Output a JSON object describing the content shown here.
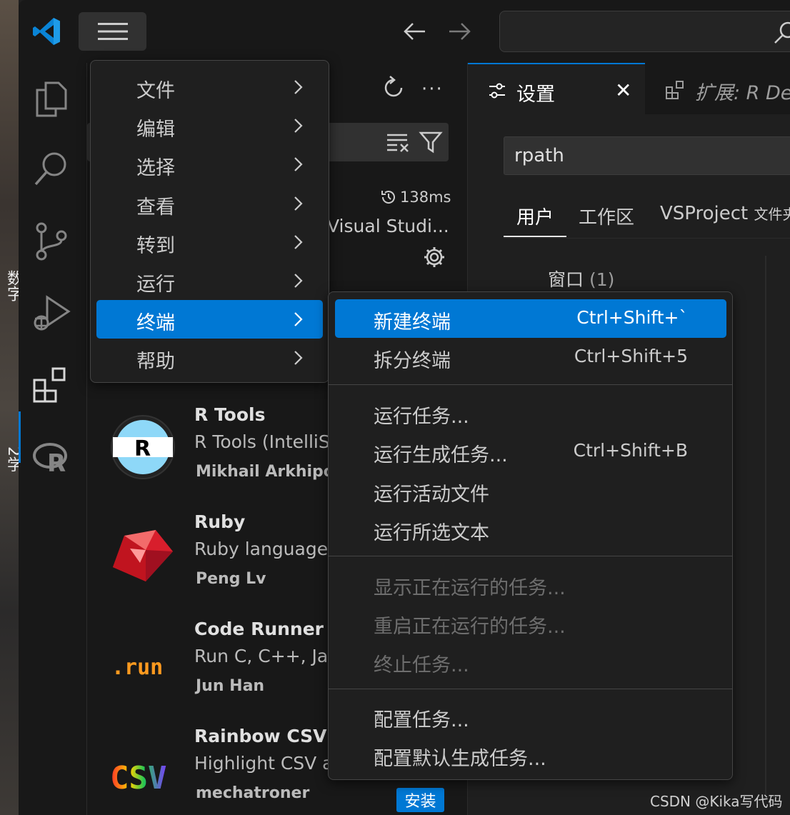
{
  "desktop": {
    "fragments": [
      "数字",
      "2学"
    ]
  },
  "titlebar": {
    "search_value": ""
  },
  "sidebar": {
    "response_time": "138ms",
    "source_label": "Visual Studi...",
    "extensions": [
      {
        "name": "R Tools",
        "description": "R Tools (IntelliSe",
        "author": "Mikhail Arkhipov",
        "icon_text": "R"
      },
      {
        "name": "Ruby",
        "description": "Ruby language",
        "author": "Peng Lv"
      },
      {
        "name": "Code Runner",
        "description": "Run C, C++, Jav",
        "author": "Jun Han",
        "icon_text": ".run"
      },
      {
        "name": "Rainbow CSV",
        "description": "Highlight CSV a",
        "author": "mechatroner",
        "icon_text": "CSV",
        "install_label": "安装"
      }
    ]
  },
  "editor": {
    "tabs": [
      {
        "label": "设置",
        "active": true
      },
      {
        "label": "扩展: R Deb",
        "active": false
      }
    ],
    "settings": {
      "search_value": "rpath",
      "scope_tabs": [
        "用户",
        "工作区",
        "VSProject"
      ],
      "scope_suffix": "文件夹",
      "tree_item": {
        "label": "窗口",
        "count": "(1)"
      }
    }
  },
  "main_menu": {
    "items": [
      {
        "label": "文件"
      },
      {
        "label": "编辑"
      },
      {
        "label": "选择"
      },
      {
        "label": "查看"
      },
      {
        "label": "转到"
      },
      {
        "label": "运行"
      },
      {
        "label": "终端",
        "selected": true
      },
      {
        "label": "帮助"
      }
    ]
  },
  "terminal_menu": {
    "groups": [
      [
        {
          "label": "新建终端",
          "shortcut": "Ctrl+Shift+`",
          "selected": true
        },
        {
          "label": "拆分终端",
          "shortcut": "Ctrl+Shift+5"
        }
      ],
      [
        {
          "label": "运行任务...",
          "shortcut": ""
        },
        {
          "label": "运行生成任务...",
          "shortcut": "Ctrl+Shift+B"
        },
        {
          "label": "运行活动文件",
          "shortcut": ""
        },
        {
          "label": "运行所选文本",
          "shortcut": ""
        }
      ],
      [
        {
          "label": "显示正在运行的任务...",
          "disabled": true
        },
        {
          "label": "重启正在运行的任务...",
          "disabled": true
        },
        {
          "label": "终止任务...",
          "disabled": true
        }
      ],
      [
        {
          "label": "配置任务...",
          "shortcut": ""
        },
        {
          "label": "配置默认生成任务...",
          "shortcut": ""
        }
      ]
    ]
  },
  "watermark": "CSDN @Kika写代码",
  "colors": {
    "accent": "#0078d4",
    "background": "#1f1f1f",
    "panel": "#181818"
  }
}
